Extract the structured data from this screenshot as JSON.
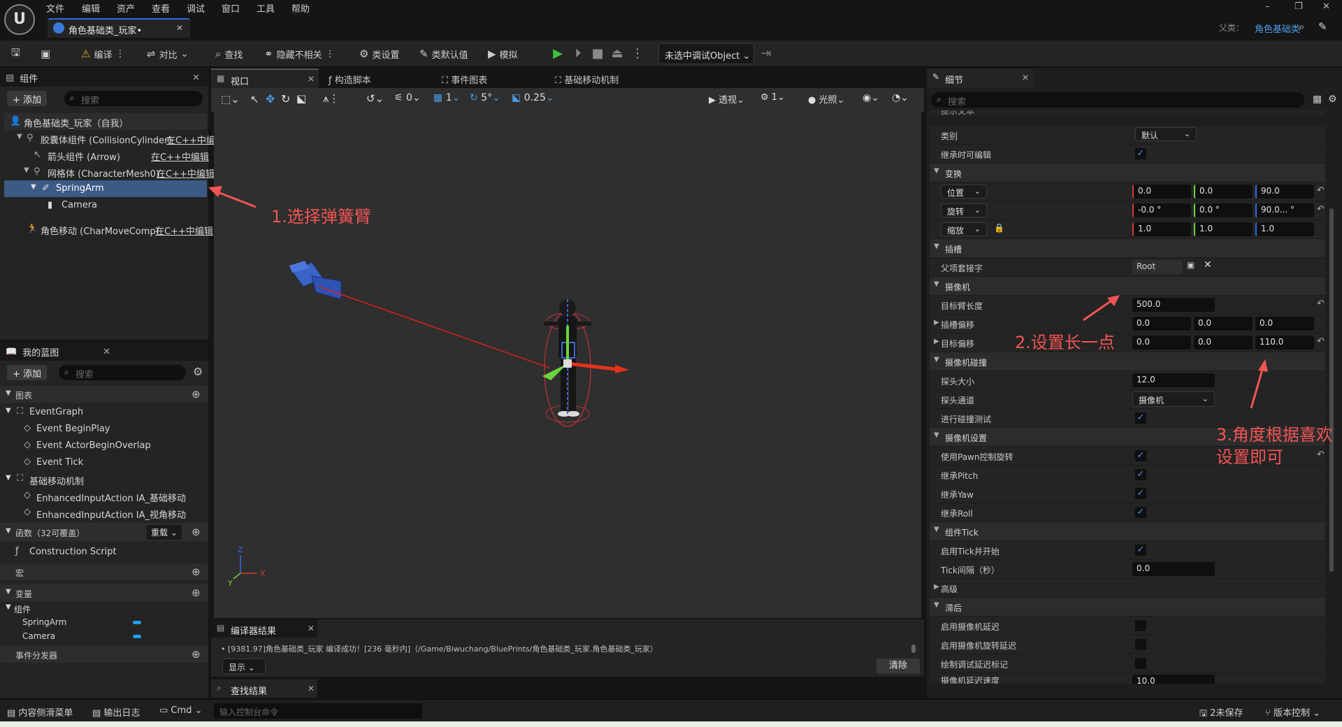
{
  "menu": [
    "文件",
    "编辑",
    "资产",
    "查看",
    "调试",
    "窗口",
    "工具",
    "帮助"
  ],
  "window_controls": [
    "–",
    "❐",
    "✕"
  ],
  "doc_tab": {
    "title": "角色基础类_玩家•",
    "close": "✕"
  },
  "parent": {
    "label": "父类：",
    "value": "角色基础类"
  },
  "toolbar": {
    "compile": "编译",
    "diff": "对比",
    "find": "查找",
    "hide_unrelated": "隐藏不相关",
    "class_settings": "类设置",
    "class_defaults": "类默认值",
    "simulate": "模拟",
    "debug_select": "未选中调试Object ⌄"
  },
  "components_panel": {
    "title": "组件",
    "add": "+ 添加",
    "search_placeholder": "搜索",
    "items": [
      {
        "label": "角色基础类_玩家（自我）",
        "link": ""
      },
      {
        "label": "胶囊体组件 (CollisionCylinder)",
        "link": "在C++中编"
      },
      {
        "label": "箭头组件 (Arrow)",
        "link": "在C++中编辑"
      },
      {
        "label": "网格体 (CharacterMesh0)",
        "link": "在C++中编辑"
      },
      {
        "label": "SpringArm",
        "link": ""
      },
      {
        "label": "Camera",
        "link": ""
      },
      {
        "label": "角色移动 (CharMoveComp)",
        "link": "在C++中编辑"
      }
    ]
  },
  "mybp_panel": {
    "title": "我的蓝图",
    "add": "+ 添加",
    "search_placeholder": "搜索",
    "graph_header": "图表",
    "event_graph": "EventGraph",
    "events": [
      "Event BeginPlay",
      "Event ActorBeginOverlap",
      "Event Tick"
    ],
    "movement_graph": "基础移动机制",
    "actions": [
      "EnhancedInputAction IA_基础移动",
      "EnhancedInputAction IA_视角移动"
    ],
    "functions_header": "函数（32可覆盖）",
    "override": "重载 ⌄",
    "construction": "Construction Script",
    "macros": "宏",
    "variables": "变量",
    "components_cat": "组件",
    "vars": [
      "SpringArm",
      "Camera"
    ],
    "dispatchers": "事件分发器"
  },
  "center_tabs": [
    "视口",
    "构造脚本",
    "事件图表",
    "基础移动机制"
  ],
  "viewport_toolbar": {
    "rot": "0",
    "grid": "1",
    "angle": "5°",
    "scale": "0.25",
    "perspective": "透视",
    "lit": "光照",
    "cam_speed": "1"
  },
  "compiler": {
    "title": "编译器结果",
    "message": "• [9381.97]角色基础类_玩家 编译成功！[236 毫秒内]（/Game/Biwuchang/BluePrints/角色基础类_玩家.角色基础类_玩家）",
    "show": "显示 ⌄",
    "clear": "清除"
  },
  "find_results": "查找结果",
  "details": {
    "title": "细节",
    "search_placeholder": "搜索",
    "tooltip_label": "提示文本",
    "category_label": "类别",
    "category_value": "默认",
    "editable_inherit": "继承时可编辑",
    "transform": "变换",
    "location": {
      "label": "位置",
      "x": "0.0",
      "y": "0.0",
      "z": "90.0"
    },
    "rotation": {
      "label": "旋转",
      "x": "-0.0 °",
      "y": "0.0 °",
      "z": "90.0... °"
    },
    "scale": {
      "label": "缩放",
      "x": "1.0",
      "y": "1.0",
      "z": "1.0"
    },
    "socket": "插槽",
    "parent_socket": "父项套接字",
    "parent_socket_value": "Root",
    "camera": "摄像机",
    "arm_length": "目标臂长度",
    "arm_length_value": "500.0",
    "socket_offset": {
      "label": "插槽偏移",
      "x": "0.0",
      "y": "0.0",
      "z": "0.0"
    },
    "target_offset": {
      "label": "目标偏移",
      "x": "0.0",
      "y": "0.0",
      "z": "110.0"
    },
    "collision": "摄像机碰撞",
    "probe_size": "探头大小",
    "probe_size_value": "12.0",
    "probe_channel": "探头通道",
    "probe_channel_value": "摄像机",
    "do_collision": "进行碰撞测试",
    "cam_settings": "摄像机设置",
    "use_pawn": "使用Pawn控制旋转",
    "inherit_pitch": "继承Pitch",
    "inherit_yaw": "继承Yaw",
    "inherit_roll": "继承Roll",
    "tick": "组件Tick",
    "start_tick": "启用Tick并开始",
    "tick_interval": "Tick间隔（秒）",
    "tick_interval_value": "0.0",
    "advanced": "高级",
    "lag": "滞后",
    "cam_lag": "启用摄像机延迟",
    "cam_rot_lag": "启用摄像机旋转延迟",
    "draw_debug": "绘制调试延迟标记",
    "lag_speed": "摄像机延迟速度",
    "lag_speed_value": "10.0"
  },
  "annotations": {
    "a1": "1.选择弹簧臂",
    "a2": "2.设置长一点",
    "a3a": "3.角度根据喜欢",
    "a3b": "设置即可"
  },
  "status": {
    "content_drawer": "内容侧滑菜单",
    "output_log": "输出日志",
    "cmd": "Cmd ⌄",
    "cmd_placeholder": "输入控制台命令",
    "unsaved": "2未保存",
    "source_control": "版本控制 ⌄"
  },
  "colors": {
    "accent": "#2a6bd6",
    "annotation": "#f25454",
    "selected": "#3c5a86",
    "checkbox": "#4a8ff2"
  }
}
